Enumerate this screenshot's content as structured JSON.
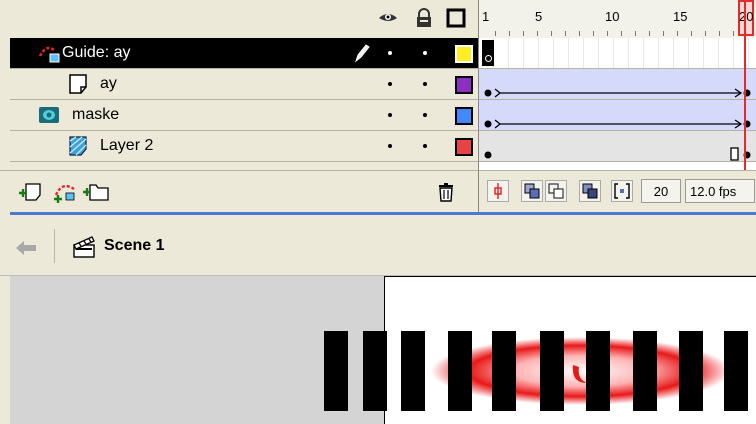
{
  "header": {
    "icons": [
      "eye-icon",
      "lock-icon",
      "outline-icon"
    ],
    "ruler_labels": [
      "1",
      "5",
      "10",
      "15",
      "20"
    ]
  },
  "layers": [
    {
      "name": "Guide: ay",
      "icon": "guide-layer-icon",
      "selected": true,
      "color": "#ffee22"
    },
    {
      "name": "ay",
      "icon": "guided-layer-icon",
      "selected": false,
      "color": "#8d2fc2"
    },
    {
      "name": "maske",
      "icon": "mask-layer-icon",
      "selected": false,
      "color": "#4488ff"
    },
    {
      "name": "Layer 2",
      "icon": "masked-layer-icon",
      "selected": false,
      "color": "#e84444"
    }
  ],
  "timeline_toolbar": {
    "current_frame": "20",
    "frame_rate": "12.0 fps"
  },
  "scene": {
    "name": "Scene 1"
  },
  "colors": {
    "playhead": "#e32b2b",
    "divider": "#4a7bd0",
    "selected_row": "#000000"
  }
}
